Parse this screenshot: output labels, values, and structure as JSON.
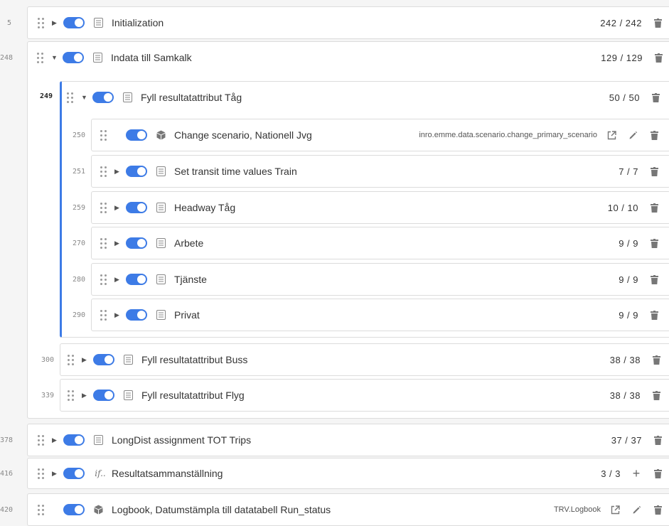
{
  "rows": {
    "initialization": {
      "line": "5",
      "label": "Initialization",
      "count": "242 / 242"
    },
    "indata": {
      "line": "248",
      "label": "Indata till Samkalk",
      "count": "129 / 129"
    },
    "fyll_tag": {
      "line": "249",
      "label": "Fyll resultatattribut Tåg",
      "count": "50 / 50"
    },
    "change_scenario": {
      "line": "250",
      "label": "Change scenario, Nationell Jvg",
      "path": "inro.emme.data.scenario.change_primary_scenario"
    },
    "set_transit": {
      "line": "251",
      "label": "Set transit time values Train",
      "count": "7 / 7"
    },
    "headway": {
      "line": "259",
      "label": "Headway Tåg",
      "count": "10 / 10"
    },
    "arbete": {
      "line": "270",
      "label": "Arbete",
      "count": "9 / 9"
    },
    "tjanste": {
      "line": "280",
      "label": "Tjänste",
      "count": "9 / 9"
    },
    "privat": {
      "line": "290",
      "label": "Privat",
      "count": "9 / 9"
    },
    "fyll_buss": {
      "line": "300",
      "label": "Fyll resultatattribut Buss",
      "count": "38 / 38"
    },
    "fyll_flyg": {
      "line": "339",
      "label": "Fyll resultatattribut Flyg",
      "count": "38 / 38"
    },
    "longdist": {
      "line": "378",
      "label": "LongDist assignment TOT Trips",
      "count": "37 / 37"
    },
    "resultat": {
      "line": "416",
      "label": "Resultatsammanställning",
      "count": "3 / 3",
      "type_icon_text": "if.."
    },
    "logbook": {
      "line": "420",
      "label": "Logbook, Datumstämpla till datatabell Run_status",
      "path": "TRV.Logbook"
    }
  },
  "colors": {
    "accent": "#3d7be6",
    "border": "#dcdcdc",
    "background": "#f5f5f5"
  },
  "icons": {
    "drag": "drag-handle-icon",
    "expand": "caret-right-icon",
    "collapse": "caret-down-icon",
    "toggle": "enabled-toggle",
    "group": "list-icon",
    "tool": "cube-icon",
    "open": "open-external-icon",
    "edit": "pencil-icon",
    "delete": "trash-icon",
    "add": "plus-icon"
  }
}
